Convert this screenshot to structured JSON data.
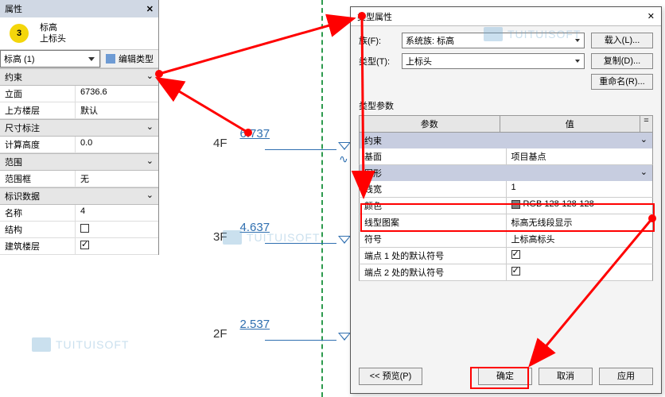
{
  "props": {
    "title": "属性",
    "circle": "3",
    "label1": "标高",
    "label2": "上标头",
    "type_selected": "标高 (1)",
    "edit_type": "编辑类型",
    "sections": {
      "constraint": "约束",
      "dim": "尺寸标注",
      "scope": "范围",
      "id": "标识数据"
    },
    "rows": {
      "elev_k": "立面",
      "elev_v": "6736.6",
      "upper_k": "上方楼层",
      "upper_v": "默认",
      "calc_k": "计算高度",
      "calc_v": "0.0",
      "scopebox_k": "范围框",
      "scopebox_v": "无",
      "name_k": "名称",
      "name_v": "4",
      "struct_k": "结构",
      "bstory_k": "建筑楼层"
    },
    "collapse": "⌄"
  },
  "levels": {
    "l4_name": "4F",
    "l4_val": "6.737",
    "l3_name": "3F",
    "l3_val": "4.637",
    "l2_name": "2F",
    "l2_val": "2.537"
  },
  "dialog": {
    "title": "类型属性",
    "family_lbl": "族(F):",
    "family_val": "系统族: 标高",
    "type_lbl": "类型(T):",
    "type_val": "上标头",
    "btn_load": "载入(L)...",
    "btn_dup": "复制(D)...",
    "btn_rename": "重命名(R)...",
    "params_lbl": "类型参数",
    "hdr_param": "参数",
    "hdr_value": "值",
    "hdr_eq": "=",
    "grp_constraint": "约束",
    "base_k": "基面",
    "base_v": "项目基点",
    "grp_graphics": "图形",
    "lineweight_k": "线宽",
    "lineweight_v": "1",
    "color_k": "颜色",
    "color_v": "RGB 128-128-128",
    "linepat_k": "线型图案",
    "linepat_v": "标高无线段显示",
    "symbol_k": "符号",
    "symbol_v": "上标高标头",
    "end1_k": "端点 1 处的默认符号",
    "end2_k": "端点 2 处的默认符号",
    "btn_prev": "<< 预览(P)",
    "btn_ok": "确定",
    "btn_cancel": "取消",
    "btn_apply": "应用",
    "expand": "⌄",
    "close_x": "✕"
  },
  "watermark": "TUITUISOFT"
}
